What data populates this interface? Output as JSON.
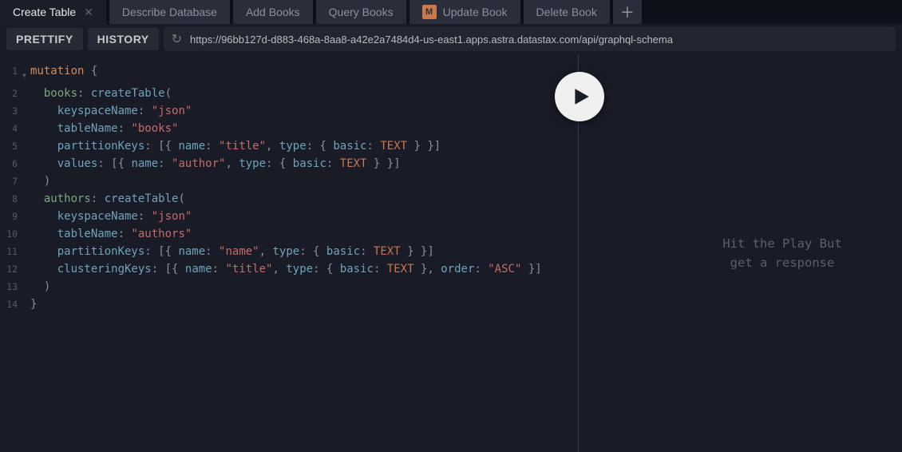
{
  "tabs": [
    {
      "label": "Create Table",
      "active": true
    },
    {
      "label": "Describe Database"
    },
    {
      "label": "Add Books"
    },
    {
      "label": "Query Books"
    },
    {
      "label": "Update Book",
      "badge": "M"
    },
    {
      "label": "Delete Book"
    }
  ],
  "toolbar": {
    "prettify": "PRETTIFY",
    "history": "HISTORY",
    "url": "https://96bb127d-d883-468a-8aa8-a42e2a7484d4-us-east1.apps.astra.datastax.com/api/graphql-schema"
  },
  "editor": {
    "lines": [
      [
        {
          "c": "t-key",
          "t": "mutation"
        },
        {
          "c": "t-punc",
          "t": " {"
        }
      ],
      [
        {
          "c": "",
          "t": "  "
        },
        {
          "c": "t-qualifier",
          "t": "books"
        },
        {
          "c": "t-punc",
          "t": ": "
        },
        {
          "c": "t-attr",
          "t": "createTable"
        },
        {
          "c": "t-punc",
          "t": "("
        }
      ],
      [
        {
          "c": "",
          "t": "    "
        },
        {
          "c": "t-attr",
          "t": "keyspaceName"
        },
        {
          "c": "t-punc",
          "t": ": "
        },
        {
          "c": "t-str",
          "t": "\"json\""
        }
      ],
      [
        {
          "c": "",
          "t": "    "
        },
        {
          "c": "t-attr",
          "t": "tableName"
        },
        {
          "c": "t-punc",
          "t": ": "
        },
        {
          "c": "t-str",
          "t": "\"books\""
        }
      ],
      [
        {
          "c": "",
          "t": "    "
        },
        {
          "c": "t-attr",
          "t": "partitionKeys"
        },
        {
          "c": "t-punc",
          "t": ": [{ "
        },
        {
          "c": "t-attr",
          "t": "name"
        },
        {
          "c": "t-punc",
          "t": ": "
        },
        {
          "c": "t-str",
          "t": "\"title\""
        },
        {
          "c": "t-punc",
          "t": ", "
        },
        {
          "c": "t-attr",
          "t": "type"
        },
        {
          "c": "t-punc",
          "t": ": { "
        },
        {
          "c": "t-attr",
          "t": "basic"
        },
        {
          "c": "t-punc",
          "t": ": "
        },
        {
          "c": "t-def",
          "t": "TEXT"
        },
        {
          "c": "t-punc",
          "t": " } }]"
        }
      ],
      [
        {
          "c": "",
          "t": "    "
        },
        {
          "c": "t-attr",
          "t": "values"
        },
        {
          "c": "t-punc",
          "t": ": [{ "
        },
        {
          "c": "t-attr",
          "t": "name"
        },
        {
          "c": "t-punc",
          "t": ": "
        },
        {
          "c": "t-str",
          "t": "\"author\""
        },
        {
          "c": "t-punc",
          "t": ", "
        },
        {
          "c": "t-attr",
          "t": "type"
        },
        {
          "c": "t-punc",
          "t": ": { "
        },
        {
          "c": "t-attr",
          "t": "basic"
        },
        {
          "c": "t-punc",
          "t": ": "
        },
        {
          "c": "t-def",
          "t": "TEXT"
        },
        {
          "c": "t-punc",
          "t": " } }]"
        }
      ],
      [
        {
          "c": "",
          "t": "  "
        },
        {
          "c": "t-punc",
          "t": ")"
        }
      ],
      [
        {
          "c": "",
          "t": "  "
        },
        {
          "c": "t-qualifier",
          "t": "authors"
        },
        {
          "c": "t-punc",
          "t": ": "
        },
        {
          "c": "t-attr",
          "t": "createTable"
        },
        {
          "c": "t-punc",
          "t": "("
        }
      ],
      [
        {
          "c": "",
          "t": "    "
        },
        {
          "c": "t-attr",
          "t": "keyspaceName"
        },
        {
          "c": "t-punc",
          "t": ": "
        },
        {
          "c": "t-str",
          "t": "\"json\""
        }
      ],
      [
        {
          "c": "",
          "t": "    "
        },
        {
          "c": "t-attr",
          "t": "tableName"
        },
        {
          "c": "t-punc",
          "t": ": "
        },
        {
          "c": "t-str",
          "t": "\"authors\""
        }
      ],
      [
        {
          "c": "",
          "t": "    "
        },
        {
          "c": "t-attr",
          "t": "partitionKeys"
        },
        {
          "c": "t-punc",
          "t": ": [{ "
        },
        {
          "c": "t-attr",
          "t": "name"
        },
        {
          "c": "t-punc",
          "t": ": "
        },
        {
          "c": "t-str",
          "t": "\"name\""
        },
        {
          "c": "t-punc",
          "t": ", "
        },
        {
          "c": "t-attr",
          "t": "type"
        },
        {
          "c": "t-punc",
          "t": ": { "
        },
        {
          "c": "t-attr",
          "t": "basic"
        },
        {
          "c": "t-punc",
          "t": ": "
        },
        {
          "c": "t-def",
          "t": "TEXT"
        },
        {
          "c": "t-punc",
          "t": " } }]"
        }
      ],
      [
        {
          "c": "",
          "t": "    "
        },
        {
          "c": "t-attr",
          "t": "clusteringKeys"
        },
        {
          "c": "t-punc",
          "t": ": [{ "
        },
        {
          "c": "t-attr",
          "t": "name"
        },
        {
          "c": "t-punc",
          "t": ": "
        },
        {
          "c": "t-str",
          "t": "\"title\""
        },
        {
          "c": "t-punc",
          "t": ", "
        },
        {
          "c": "t-attr",
          "t": "type"
        },
        {
          "c": "t-punc",
          "t": ": { "
        },
        {
          "c": "t-attr",
          "t": "basic"
        },
        {
          "c": "t-punc",
          "t": ": "
        },
        {
          "c": "t-def",
          "t": "TEXT"
        },
        {
          "c": "t-punc",
          "t": " }, "
        },
        {
          "c": "t-attr",
          "t": "order"
        },
        {
          "c": "t-punc",
          "t": ": "
        },
        {
          "c": "t-str",
          "t": "\"ASC\""
        },
        {
          "c": "t-punc",
          "t": " }]"
        }
      ],
      [
        {
          "c": "",
          "t": "  "
        },
        {
          "c": "t-punc",
          "t": ")"
        }
      ],
      [
        {
          "c": "t-punc",
          "t": "}"
        }
      ]
    ]
  },
  "results": {
    "hint_line1": "Hit the Play But",
    "hint_line2": "get a response"
  }
}
